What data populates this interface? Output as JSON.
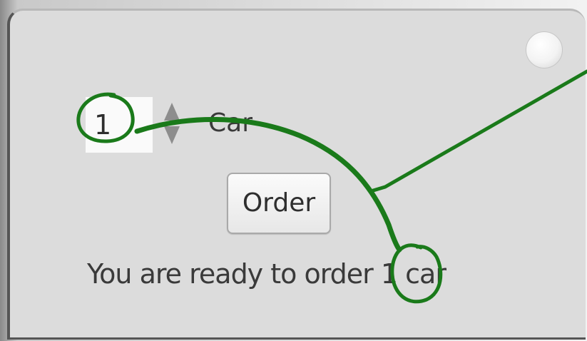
{
  "spinner": {
    "value": "1",
    "unit_label": "Car"
  },
  "order_button": {
    "label": "Order"
  },
  "status": {
    "text": "You are ready to order 1 car"
  },
  "annotation": {
    "color": "#1a7a1a",
    "style": "hand-drawn"
  },
  "colors": {
    "window_bg": "#dcdcdc",
    "input_bg": "#fafafa",
    "text": "#3a3a3a"
  }
}
